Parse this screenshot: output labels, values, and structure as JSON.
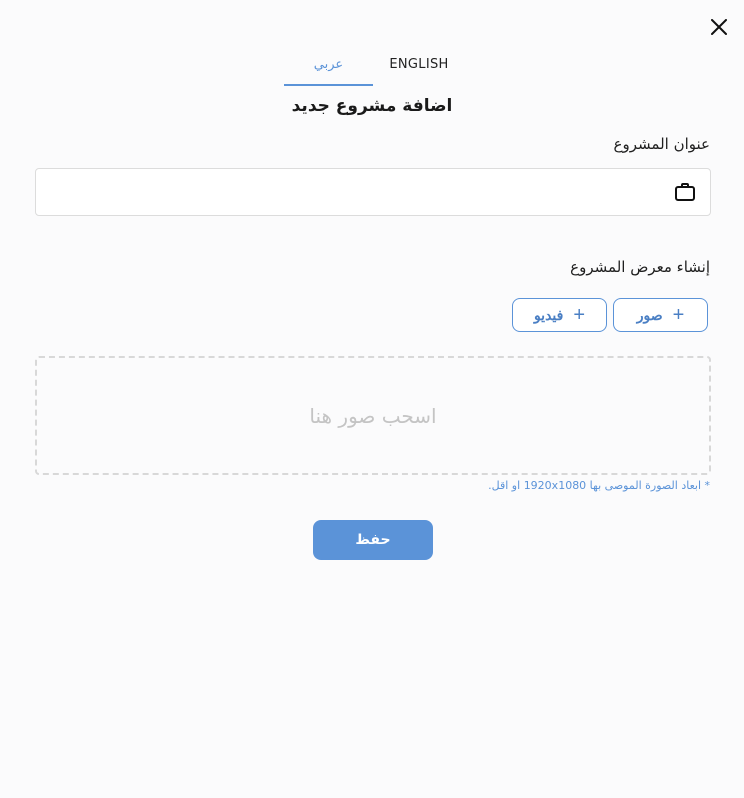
{
  "tabs": {
    "arabic": "عربي",
    "english": "ENGLISH"
  },
  "title": "اضافة مشروع جديد",
  "project_title": {
    "label": "عنوان المشروع",
    "value": "",
    "placeholder": ""
  },
  "gallery": {
    "label": "إنشاء معرض المشروع",
    "images_button": "صور",
    "video_button": "فيديو",
    "dropzone_text": "اسحب صور هنا",
    "hint": "* ابعاد الصورة الموصى بها 1920x1080 او اقل."
  },
  "save_button": "حفظ",
  "colors": {
    "accent": "#5b93d8"
  }
}
